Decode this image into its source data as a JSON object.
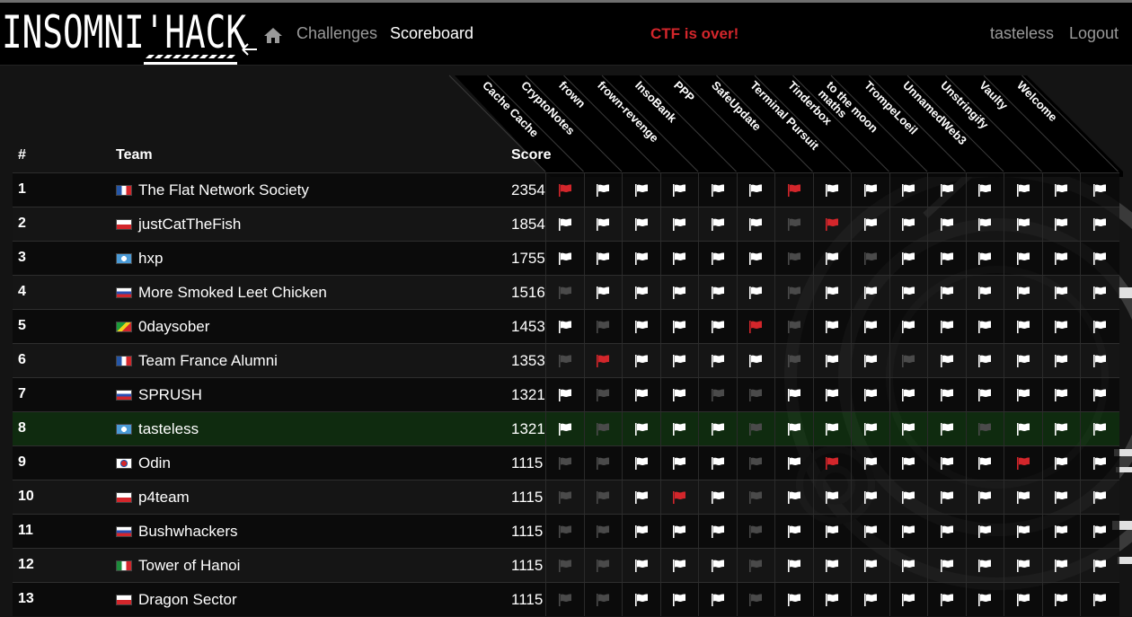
{
  "navbar": {
    "logo_text": "INSOMNI'HACK",
    "challenges_label": "Challenges",
    "scoreboard_label": "Scoreboard",
    "status_text": "CTF is over!",
    "user_label": "tasteless",
    "logout_label": "Logout"
  },
  "table": {
    "headers": {
      "rank": "#",
      "team": "Team",
      "score": "Score"
    },
    "challenges": [
      "Cache Cache",
      "CryptoNotes",
      "frown",
      "frown-revenge",
      "InsoBank",
      "PPP",
      "SafeUpdate",
      "Terminal Pursuit",
      "Tinderbox",
      "to the moon\nmaths",
      "TrompeLoeil",
      "UnnamedWeb3",
      "Unstringify",
      "Vaulty",
      "Welcome"
    ],
    "colors": {
      "solved": "#ffffff",
      "unsolved": "#4a4a4a",
      "first_blood": "#d3262b",
      "highlight_row": "#0e320e"
    },
    "rows": [
      {
        "rank": "1",
        "team": "The Flat Network Society",
        "country": "fr",
        "score": "2354",
        "flags": "RWWWWWRWWWWWWWW"
      },
      {
        "rank": "2",
        "team": "justCatTheFish",
        "country": "pl",
        "score": "1854",
        "flags": "WWWWWWURWWWWWWW"
      },
      {
        "rank": "3",
        "team": "hxp",
        "country": "un",
        "score": "1755",
        "flags": "WWWWWWUWUWWWWWW"
      },
      {
        "rank": "4",
        "team": "More Smoked Leet Chicken",
        "country": "ru",
        "score": "1516",
        "flags": "UWWWWWUWWWWWWWW"
      },
      {
        "rank": "5",
        "team": "0daysober",
        "country": "cg",
        "score": "1453",
        "flags": "WUWWWRUWWWWWWWW"
      },
      {
        "rank": "6",
        "team": "Team France Alumni",
        "country": "fr",
        "score": "1353",
        "flags": "URWWWWUWWUWWWWW"
      },
      {
        "rank": "7",
        "team": "SPRUSH",
        "country": "ru",
        "score": "1321",
        "flags": "WUWWUUWWWWWWWWW"
      },
      {
        "rank": "8",
        "team": "tasteless",
        "country": "un",
        "score": "1321",
        "flags": "WUWWWUWWWWWUWWW",
        "highlight": true
      },
      {
        "rank": "9",
        "team": "Odin",
        "country": "kr",
        "score": "1115",
        "flags": "UUWWWUWRWWWWRWW"
      },
      {
        "rank": "10",
        "team": "p4team",
        "country": "pl",
        "score": "1115",
        "flags": "UUWRWUWWWWWWWWW"
      },
      {
        "rank": "11",
        "team": "Bushwhackers",
        "country": "ru",
        "score": "1115",
        "flags": "UUWWWUWWWWWWWWW"
      },
      {
        "rank": "12",
        "team": "Tower of Hanoi",
        "country": "it",
        "score": "1115",
        "flags": "UUWWWUWWWWWWWWW"
      },
      {
        "rank": "13",
        "team": "Dragon Sector",
        "country": "pl",
        "score": "1115",
        "flags": "UUWWWUWWWWWWWWW"
      }
    ]
  }
}
